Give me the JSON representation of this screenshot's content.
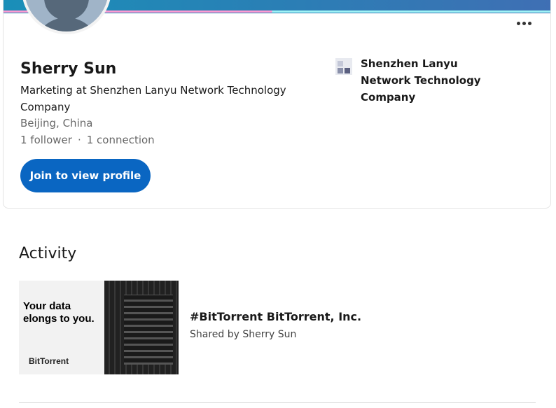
{
  "profile": {
    "name": "Sherry Sun",
    "headline": "Marketing at Shenzhen Lanyu Network Technology Company",
    "location": "Beijing, China",
    "followers": "1 follower",
    "stats_separator": "·",
    "connections": "1 connection",
    "join_button_label": "Join to view profile",
    "company_name": "Shenzhen Lanyu Network Technology Company"
  },
  "activity": {
    "title": "Activity",
    "post": {
      "title": "#BitTorrent BitTorrent, Inc.",
      "meta": "Shared by Sherry Sun",
      "thumb_text": "Your data\nelongs to you.",
      "thumb_brand": "BitTorrent"
    }
  },
  "colors": {
    "primary_button": "#0a66c2",
    "cover_start": "#1a8fb8",
    "cover_end": "#3f6fb4"
  },
  "icons": {
    "overflow": "ellipsis-icon",
    "avatar": "default-avatar-icon",
    "company_logo": "company-logo-icon"
  }
}
